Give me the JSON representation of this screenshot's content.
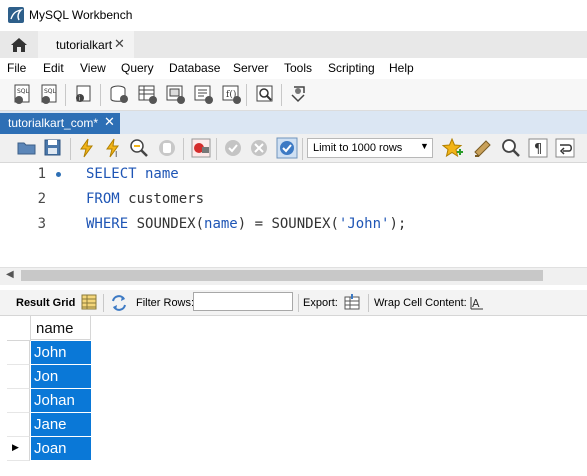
{
  "window": {
    "title": "MySQL Workbench"
  },
  "connection_tab": {
    "label": "tutorialkart",
    "close": "✕"
  },
  "menu": [
    "File",
    "Edit",
    "View",
    "Query",
    "Database",
    "Server",
    "Tools",
    "Scripting",
    "Help"
  ],
  "editor_tab": {
    "label": "tutorialkart_com*",
    "close": "✕"
  },
  "sql_toolbar": {
    "limit": "Limit to 1000 rows"
  },
  "editor": {
    "line_numbers": [
      "1",
      "2",
      "3"
    ],
    "lines": [
      {
        "t1": "SELECT",
        "t2": " name"
      },
      {
        "t1": "FROM",
        "t2": " customers"
      },
      {
        "t1": "WHERE",
        "t2": " SOUNDEX(",
        "t3": "name",
        "t4": ") = SOUNDEX(",
        "t5": "'John'",
        "t6": ");"
      }
    ]
  },
  "result_toolbar": {
    "result_grid": "Result Grid",
    "filter_rows": "Filter Rows:",
    "filter_value": "",
    "export": "Export:",
    "wrap": "Wrap Cell Content:"
  },
  "grid": {
    "column": "name",
    "rows": [
      "John",
      "Jon",
      "Johan",
      "Jane",
      "Joan"
    ],
    "current_row_index": 4
  }
}
